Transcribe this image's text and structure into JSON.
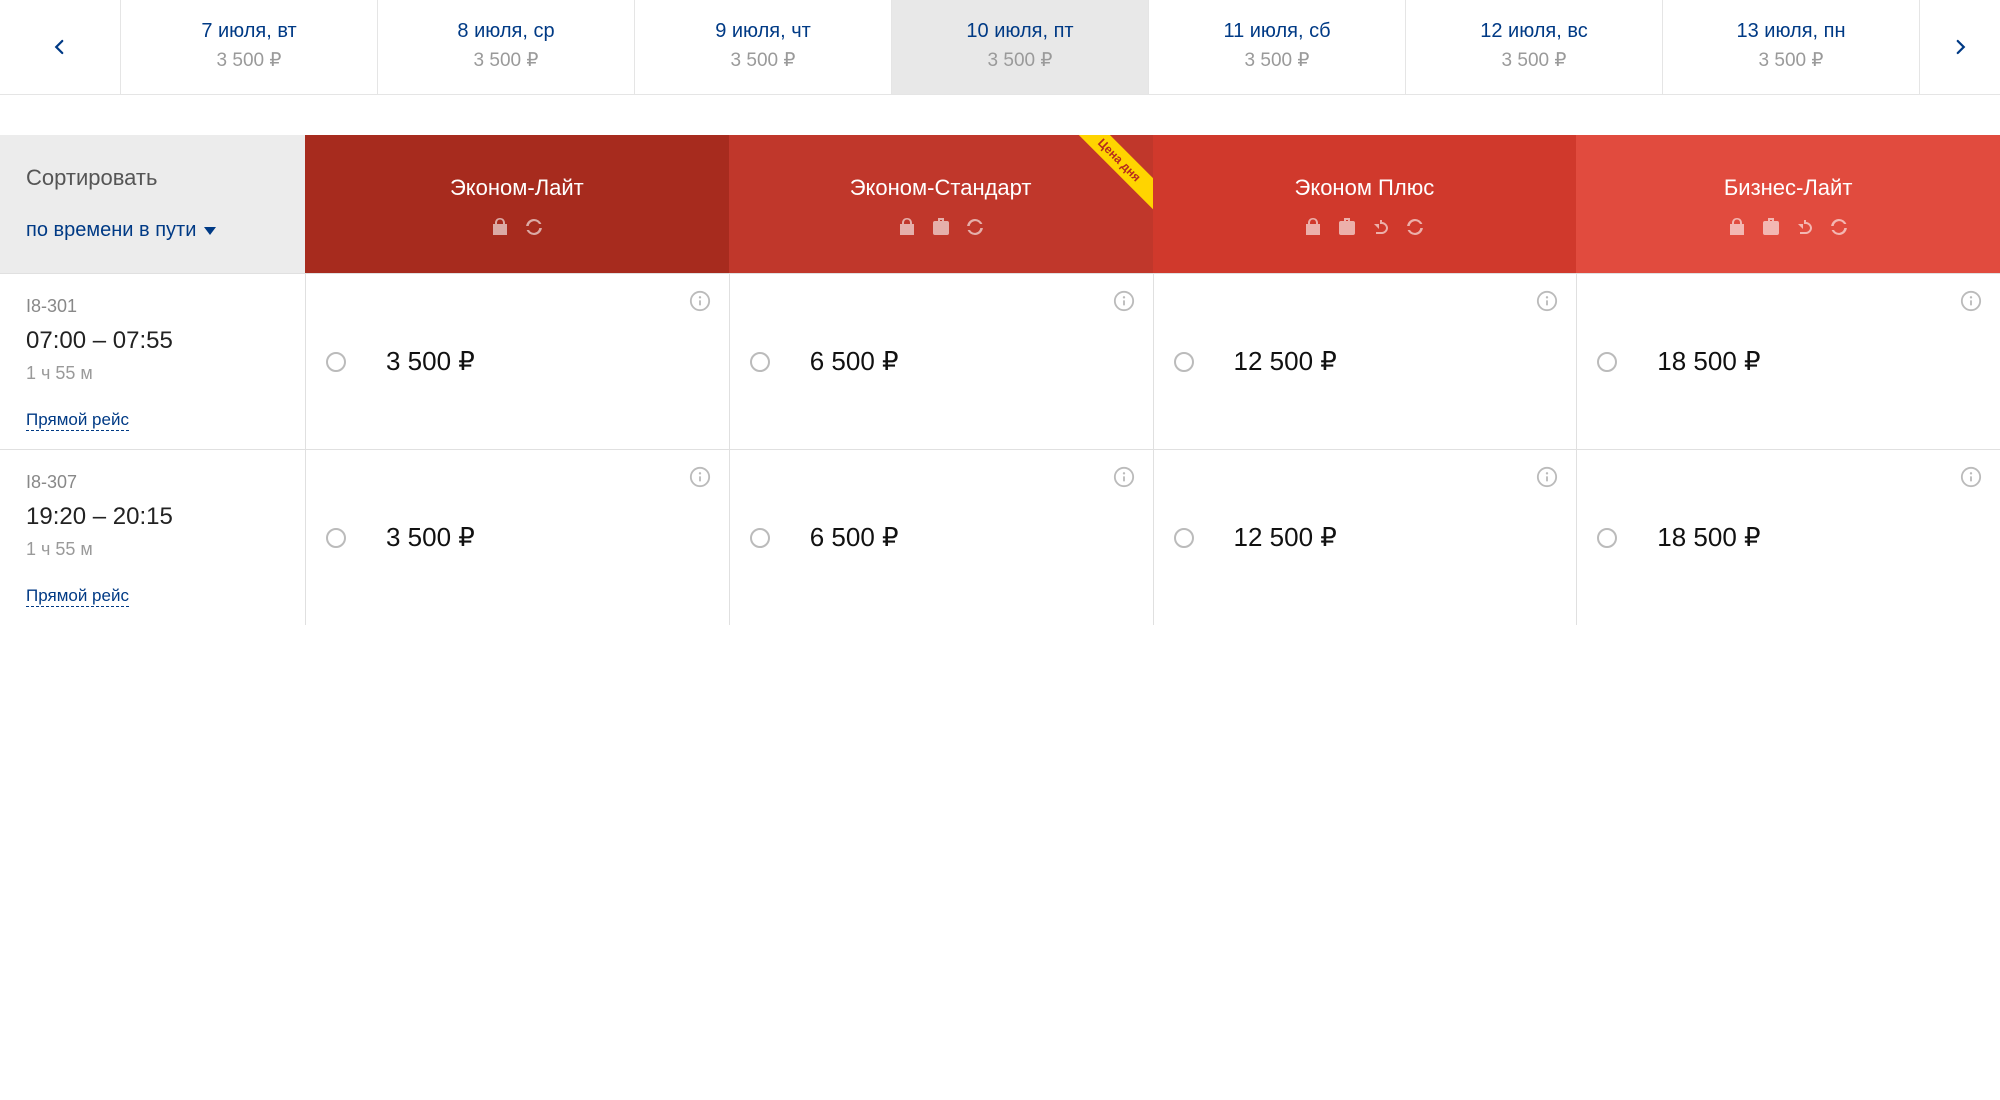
{
  "dates": [
    {
      "label": "7 июля, вт",
      "price": "3 500 ₽",
      "selected": false
    },
    {
      "label": "8 июля, ср",
      "price": "3 500 ₽",
      "selected": false
    },
    {
      "label": "9 июля, чт",
      "price": "3 500 ₽",
      "selected": false
    },
    {
      "label": "10 июля, пт",
      "price": "3 500 ₽",
      "selected": true
    },
    {
      "label": "11 июля, сб",
      "price": "3 500 ₽",
      "selected": false
    },
    {
      "label": "12 июля, вс",
      "price": "3 500 ₽",
      "selected": false
    },
    {
      "label": "13 июля, пн",
      "price": "3 500 ₽",
      "selected": false
    }
  ],
  "sort": {
    "title": "Сортировать",
    "value": "по времени в пути"
  },
  "fare_classes": [
    {
      "name": "Эконом-Лайт",
      "icons": [
        "bag",
        "refresh"
      ],
      "badge": null
    },
    {
      "name": "Эконом-Стандарт",
      "icons": [
        "bag",
        "luggage",
        "refresh"
      ],
      "badge": "Цена дня"
    },
    {
      "name": "Эконом Плюс",
      "icons": [
        "bag",
        "luggage",
        "return",
        "refresh"
      ],
      "badge": null
    },
    {
      "name": "Бизнес-Лайт",
      "icons": [
        "bag",
        "luggage",
        "return",
        "refresh"
      ],
      "badge": null
    }
  ],
  "flights": [
    {
      "number": "I8-301",
      "time": "07:00 – 07:55",
      "duration": "1 ч 55 м",
      "direct": "Прямой рейс",
      "prices": [
        "3 500 ₽",
        "6 500 ₽",
        "12 500 ₽",
        "18 500 ₽"
      ]
    },
    {
      "number": "I8-307",
      "time": "19:20 – 20:15",
      "duration": "1 ч 55 м",
      "direct": "Прямой рейс",
      "prices": [
        "3 500 ₽",
        "6 500 ₽",
        "12 500 ₽",
        "18 500 ₽"
      ]
    }
  ]
}
